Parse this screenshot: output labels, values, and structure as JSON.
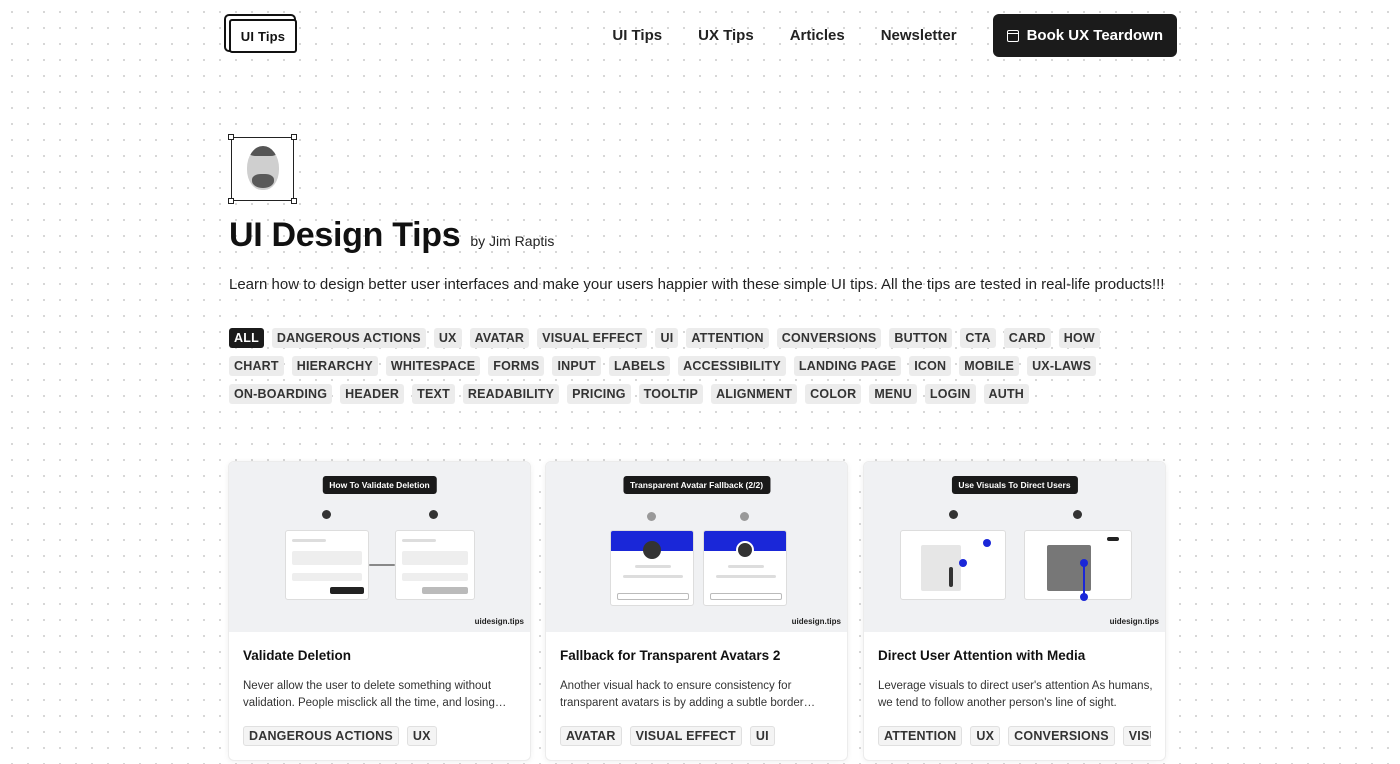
{
  "header": {
    "logo": "UI Tips",
    "nav": [
      "UI Tips",
      "UX Tips",
      "Articles",
      "Newsletter"
    ],
    "cta_label": "Book UX Teardown",
    "cta_icon": "calendar-icon"
  },
  "profile": {
    "title": "UI Design Tips",
    "byline": "by Jim Raptis",
    "intro": "Learn how to design better user interfaces and make your users happier with these simple UI tips. All the tips are tested in real-life products!!!"
  },
  "tags": [
    "ALL",
    "DANGEROUS ACTIONS",
    "UX",
    "AVATAR",
    "VISUAL EFFECT",
    "UI",
    "ATTENTION",
    "CONVERSIONS",
    "BUTTON",
    "CTA",
    "CARD",
    "HOW",
    "CHART",
    "HIERARCHY",
    "WHITESPACE",
    "FORMS",
    "INPUT",
    "LABELS",
    "ACCESSIBILITY",
    "LANDING PAGE",
    "ICON",
    "MOBILE",
    "UX-LAWS",
    "ON-BOARDING",
    "HEADER",
    "TEXT",
    "READABILITY",
    "PRICING",
    "TOOLTIP",
    "ALIGNMENT",
    "COLOR",
    "MENU",
    "LOGIN",
    "AUTH"
  ],
  "active_tag": "ALL",
  "cards": [
    {
      "thumb_label": "How To Validate Deletion",
      "thumb_brand": "uidesign.tips",
      "title": "Validate Deletion",
      "desc": "Never allow the user to delete something without validation. People misclick all the time, and losing data is frustrating.",
      "tags": [
        "DANGEROUS ACTIONS",
        "UX"
      ]
    },
    {
      "thumb_label": "Transparent Avatar Fallback (2/2)",
      "thumb_brand": "uidesign.tips",
      "title": "Fallback for Transparent Avatars 2",
      "desc": "Another visual hack to ensure consistency for transparent avatars is by adding a subtle border around them.",
      "tags": [
        "AVATAR",
        "VISUAL EFFECT",
        "UI"
      ]
    },
    {
      "thumb_label": "Use Visuals To Direct Users",
      "thumb_brand": "uidesign.tips",
      "title": "Direct User Attention with Media",
      "desc": "Leverage visuals to direct user's attention As humans, we tend to follow another person's line of sight.",
      "tags": [
        "ATTENTION",
        "UX",
        "CONVERSIONS",
        "VISUAL EFFECT"
      ]
    }
  ]
}
